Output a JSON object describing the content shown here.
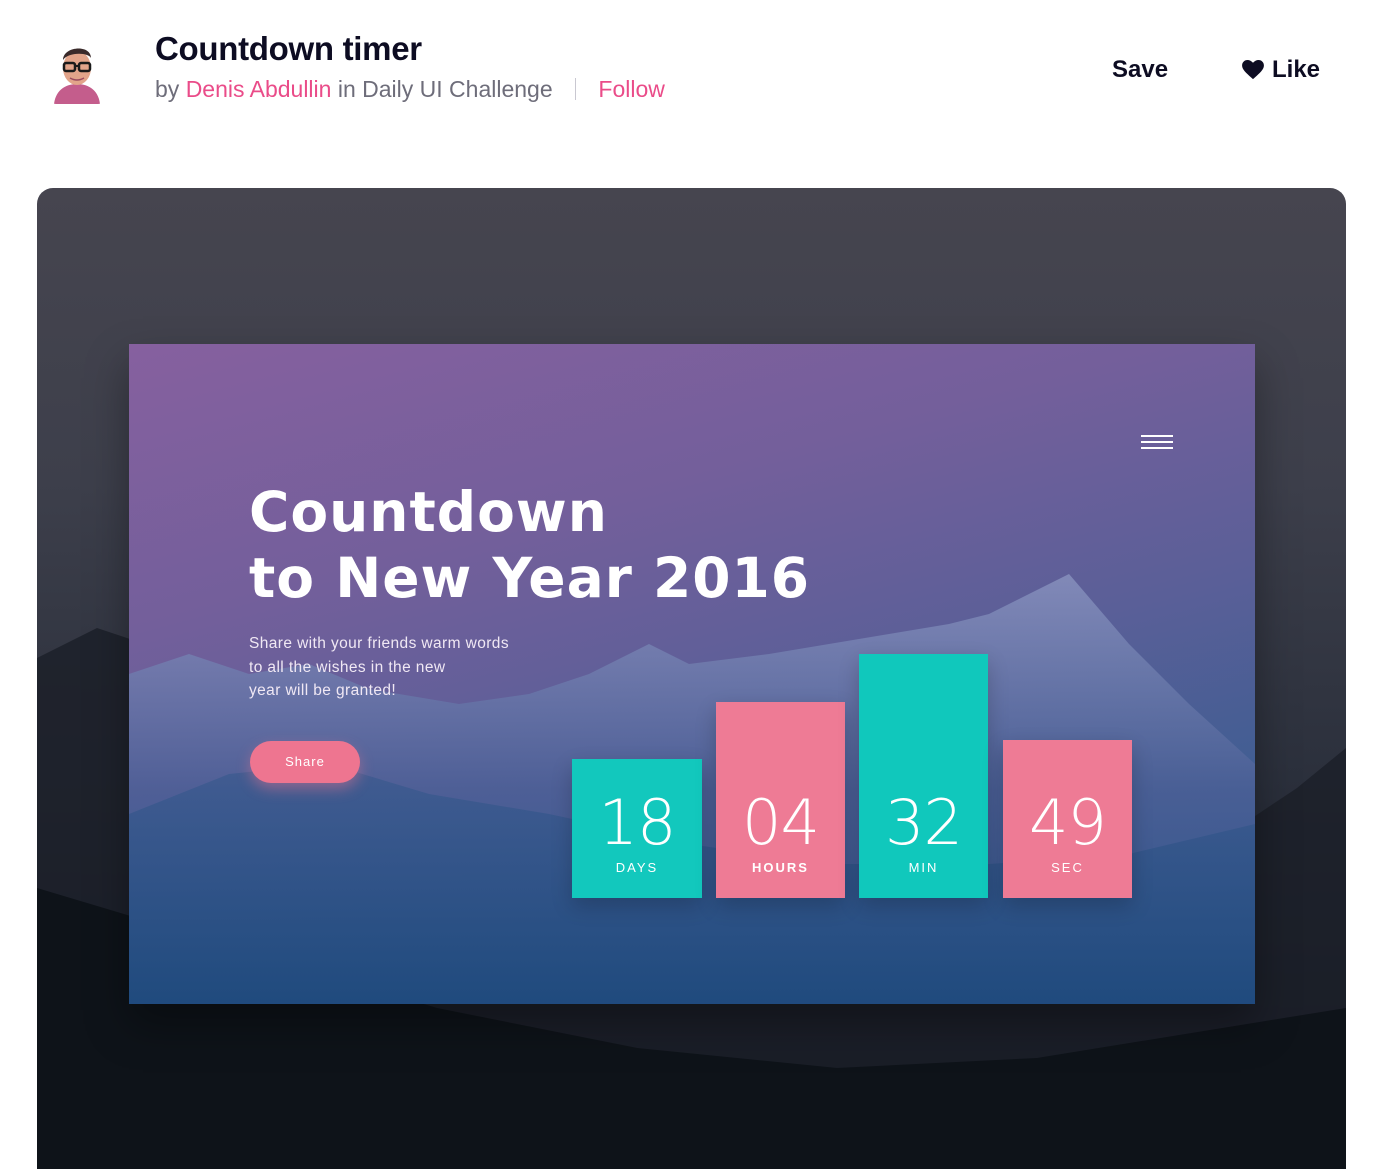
{
  "header": {
    "title": "Countdown timer",
    "by": "by",
    "author": "Denis Abdullin",
    "in": "in",
    "team": "Daily UI Challenge",
    "follow": "Follow",
    "save_label": "Save",
    "like_label": "Like"
  },
  "shot": {
    "title_line1": "Countdown",
    "title_line2": "to New Year 2016",
    "description_line1": "Share with your friends warm words",
    "description_line2": "to all the wishes in the new",
    "description_line3": "year will be granted!",
    "share_label": "Share",
    "countdown": [
      {
        "value": "18",
        "unit": "DAYS"
      },
      {
        "value": "04",
        "unit": "HOURS"
      },
      {
        "value": "32",
        "unit": "MIN"
      },
      {
        "value": "49",
        "unit": "SEC"
      }
    ]
  },
  "colors": {
    "accent_pink": "#ea4c89",
    "tile_teal": "#12c8bd",
    "tile_pink": "#ee7b95",
    "text_dark": "#0d0c22",
    "text_muted": "#6e6d7a"
  },
  "icons": {
    "like": "heart-icon",
    "menu": "hamburger-menu-icon"
  }
}
